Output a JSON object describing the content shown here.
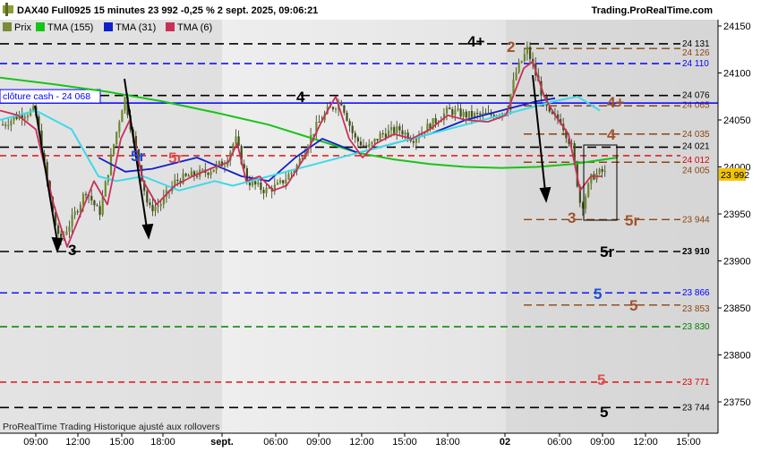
{
  "header": {
    "title": "DAX40 Full0925 15 minutes 23 992 -0,25 % 2 sept. 2025, 09:06:21",
    "brand": "Trading.ProRealTime.com"
  },
  "legend": [
    {
      "label": "Prix",
      "color": "#7a8c3a"
    },
    {
      "label": "TMA (155)",
      "color": "#18c418"
    },
    {
      "label": "TMA (31)",
      "color": "#1020c8"
    },
    {
      "label": "TMA (6)",
      "color": "#c8305a"
    }
  ],
  "footer": {
    "note": "ProRealTime Trading  Historique ajusté aux rollovers"
  },
  "cloture_cash": {
    "label": "clôture cash -  24 068",
    "value": 24068,
    "color": "#0000ff"
  },
  "chart_data": {
    "type": "line",
    "title": "DAX40 Full0925 15 minutes",
    "x_ticks": [
      "09:00",
      "12:00",
      "15:00",
      "18:00",
      "sept.",
      "06:00",
      "09:00",
      "12:00",
      "15:00",
      "18:00",
      "02",
      "06:00",
      "09:00",
      "12:00",
      "15:00"
    ],
    "y_ticks": [
      24150,
      24100,
      24050,
      24000,
      23950,
      23900,
      23850,
      23800,
      23750
    ],
    "ylim": [
      23727,
      24156
    ],
    "last_price": {
      "label": "23 992",
      "value": 23992
    },
    "levels": [
      {
        "value": 24131,
        "label": "24 131",
        "color": "#000000",
        "style": "dash"
      },
      {
        "value": 24126,
        "label": "24 126",
        "color": "#8b4513",
        "style": "dash"
      },
      {
        "value": 24110,
        "label": "24 110",
        "color": "#0000ff",
        "style": "dash"
      },
      {
        "value": 24076,
        "label": "24 076",
        "color": "#000000",
        "style": "dash"
      },
      {
        "value": 24065,
        "label": "24 065",
        "color": "#8b4513",
        "style": "dash"
      },
      {
        "value": 24035,
        "label": "24 035",
        "color": "#8b4513",
        "style": "dash"
      },
      {
        "value": 24021,
        "label": "24 021",
        "color": "#000000",
        "style": "dash"
      },
      {
        "value": 24012,
        "label": "24 012",
        "color": "#e00000",
        "style": "dash"
      },
      {
        "value": 24005,
        "label": "24 005",
        "color": "#8b4513",
        "style": "dash"
      },
      {
        "value": 23944,
        "label": "23 944",
        "color": "#8b4513",
        "style": "dash"
      },
      {
        "value": 23910,
        "label": "23 910",
        "color": "#000000",
        "style": "dash"
      },
      {
        "value": 23866,
        "label": "23 866",
        "color": "#0000ff",
        "style": "dash"
      },
      {
        "value": 23853,
        "label": "23 853",
        "color": "#8b4513",
        "style": "dash"
      },
      {
        "value": 23830,
        "label": "23 830",
        "color": "#008000",
        "style": "dash"
      },
      {
        "value": 23771,
        "label": "23 771",
        "color": "#e00000",
        "style": "dash"
      },
      {
        "value": 23744,
        "label": "23 744",
        "color": "#000000",
        "style": "dash"
      }
    ],
    "wave_labels": [
      {
        "text": "3",
        "color": "#000000"
      },
      {
        "text": "5r",
        "color": "#1a4ed8"
      },
      {
        "text": "5r",
        "color": "#e05050"
      },
      {
        "text": "4",
        "color": "#000000"
      },
      {
        "text": "4+",
        "color": "#000000"
      },
      {
        "text": "2",
        "color": "#a0522d"
      },
      {
        "text": "4+",
        "color": "#a0522d"
      },
      {
        "text": "4",
        "color": "#a0522d"
      },
      {
        "text": "3",
        "color": "#a0522d"
      },
      {
        "text": "5r",
        "color": "#a0522d"
      },
      {
        "text": "5r",
        "color": "#000000"
      },
      {
        "text": "5",
        "color": "#1a4ed8"
      },
      {
        "text": "5",
        "color": "#a0522d"
      },
      {
        "text": "5",
        "color": "#e05050"
      },
      {
        "text": "5",
        "color": "#000000"
      }
    ],
    "series": [
      {
        "name": "TMA (155)",
        "color": "#18c418",
        "points": [
          [
            0,
            24095
          ],
          [
            60,
            24088
          ],
          [
            120,
            24080
          ],
          [
            180,
            24070
          ],
          [
            240,
            24058
          ],
          [
            300,
            24045
          ],
          [
            350,
            24030
          ],
          [
            400,
            24015
          ],
          [
            440,
            24008
          ],
          [
            480,
            24003
          ],
          [
            520,
            24000
          ],
          [
            560,
            23999
          ],
          [
            600,
            24000
          ],
          [
            640,
            24003
          ],
          [
            690,
            24010
          ]
        ]
      },
      {
        "name": "TMA (31)",
        "color": "#1020c8",
        "points": [
          [
            110,
            24010
          ],
          [
            140,
            23995
          ],
          [
            170,
            23998
          ],
          [
            220,
            24010
          ],
          [
            270,
            23990
          ],
          [
            300,
            23985
          ],
          [
            330,
            24010
          ],
          [
            360,
            24030
          ],
          [
            400,
            24015
          ],
          [
            440,
            24025
          ],
          [
            480,
            24035
          ],
          [
            520,
            24050
          ],
          [
            560,
            24060
          ],
          [
            600,
            24070
          ],
          [
            620,
            24073
          ]
        ]
      },
      {
        "name": "TMA (6) cyan",
        "color": "#40d8e8",
        "points": [
          [
            0,
            24050
          ],
          [
            40,
            24060
          ],
          [
            80,
            24040
          ],
          [
            110,
            23990
          ],
          [
            130,
            23985
          ],
          [
            160,
            23990
          ],
          [
            200,
            23975
          ],
          [
            240,
            23985
          ],
          [
            260,
            23980
          ],
          [
            620,
            24070
          ],
          [
            645,
            24075
          ],
          [
            670,
            24060
          ]
        ]
      },
      {
        "name": "TMA (6)",
        "color": "#c8305a",
        "points": [
          [
            0,
            24060
          ],
          [
            20,
            24055
          ],
          [
            40,
            24040
          ],
          [
            60,
            23960
          ],
          [
            75,
            23915
          ],
          [
            90,
            23950
          ],
          [
            105,
            23985
          ],
          [
            120,
            23960
          ],
          [
            135,
            24030
          ],
          [
            145,
            24050
          ],
          [
            160,
            23985
          ],
          [
            175,
            23960
          ],
          [
            195,
            23980
          ],
          [
            215,
            23990
          ],
          [
            240,
            24000
          ],
          [
            255,
            24005
          ],
          [
            265,
            24025
          ],
          [
            275,
            23985
          ],
          [
            290,
            23990
          ],
          [
            305,
            23975
          ],
          [
            320,
            23980
          ],
          [
            340,
            24010
          ],
          [
            360,
            24050
          ],
          [
            375,
            24075
          ],
          [
            390,
            24030
          ],
          [
            405,
            24010
          ],
          [
            420,
            24025
          ],
          [
            440,
            24035
          ],
          [
            460,
            24030
          ],
          [
            480,
            24040
          ],
          [
            500,
            24055
          ],
          [
            520,
            24050
          ],
          [
            545,
            24048
          ],
          [
            565,
            24055
          ],
          [
            585,
            24105
          ],
          [
            595,
            24112
          ],
          [
            608,
            24075
          ],
          [
            620,
            24055
          ],
          [
            635,
            24035
          ],
          [
            648,
            23975
          ],
          [
            660,
            23990
          ],
          [
            672,
            23990
          ]
        ]
      }
    ]
  }
}
